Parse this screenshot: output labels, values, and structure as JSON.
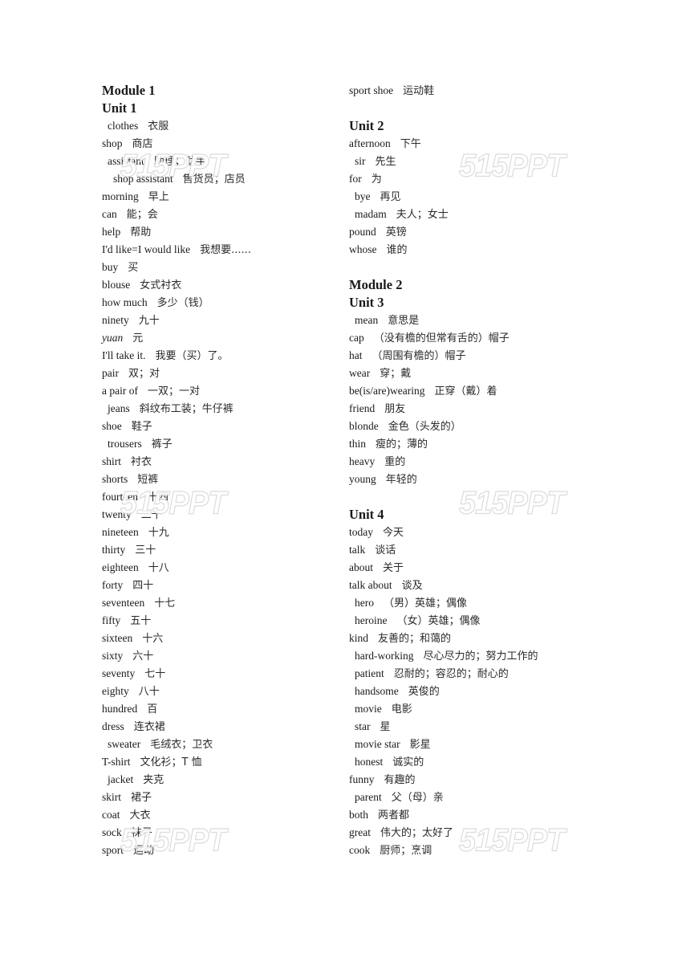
{
  "left_column": [
    {
      "type": "heading",
      "text": "Module 1"
    },
    {
      "type": "heading",
      "text": "Unit 1"
    },
    {
      "type": "entry",
      "en": "clothes",
      "zh": "衣服",
      "indent": 1
    },
    {
      "type": "entry",
      "en": "shop",
      "zh": "商店",
      "indent": 0
    },
    {
      "type": "entry",
      "en": "assistant",
      "zh": "助理；助手",
      "indent": 1
    },
    {
      "type": "entry",
      "en": "shop assistant",
      "zh": "售货员；店员",
      "indent": 2
    },
    {
      "type": "entry",
      "en": "morning",
      "zh": "早上",
      "indent": 0
    },
    {
      "type": "entry",
      "en": "can",
      "zh": "能；会",
      "indent": 0
    },
    {
      "type": "entry",
      "en": "help",
      "zh": "帮助",
      "indent": 0
    },
    {
      "type": "entry",
      "en": "I'd like=I would like",
      "zh": "我想要......",
      "indent": 0
    },
    {
      "type": "entry",
      "en": "buy",
      "zh": "买",
      "indent": 0
    },
    {
      "type": "entry",
      "en": "blouse",
      "zh": "女式衬衣",
      "indent": 0
    },
    {
      "type": "entry",
      "en": "how much",
      "zh": "多少（钱）",
      "indent": 0
    },
    {
      "type": "entry",
      "en": "ninety",
      "zh": "九十",
      "indent": 0
    },
    {
      "type": "entry",
      "en": "yuan",
      "zh": "元",
      "indent": 0,
      "italic": true
    },
    {
      "type": "entry",
      "en": "I'll take it.",
      "zh": "我要（买）了。",
      "indent": 0
    },
    {
      "type": "entry",
      "en": "pair",
      "zh": "双；对",
      "indent": 0
    },
    {
      "type": "entry",
      "en": "a pair of",
      "zh": "一双；一对",
      "indent": 0
    },
    {
      "type": "entry",
      "en": "jeans",
      "zh": "斜纹布工装；牛仔裤",
      "indent": 1
    },
    {
      "type": "entry",
      "en": "shoe",
      "zh": "鞋子",
      "indent": 0
    },
    {
      "type": "entry",
      "en": "trousers",
      "zh": "裤子",
      "indent": 1
    },
    {
      "type": "entry",
      "en": "shirt",
      "zh": "衬衣",
      "indent": 0
    },
    {
      "type": "entry",
      "en": "shorts",
      "zh": "短裤",
      "indent": 0
    },
    {
      "type": "entry",
      "en": "fourteen",
      "zh": "十四",
      "indent": 0
    },
    {
      "type": "entry",
      "en": "twenty",
      "zh": "二十",
      "indent": 0
    },
    {
      "type": "entry",
      "en": "nineteen",
      "zh": "十九",
      "indent": 0
    },
    {
      "type": "entry",
      "en": "thirty",
      "zh": "三十",
      "indent": 0
    },
    {
      "type": "entry",
      "en": "eighteen",
      "zh": "十八",
      "indent": 0
    },
    {
      "type": "entry",
      "en": "forty",
      "zh": "四十",
      "indent": 0
    },
    {
      "type": "entry",
      "en": "seventeen",
      "zh": "十七",
      "indent": 0
    },
    {
      "type": "entry",
      "en": "fifty",
      "zh": "五十",
      "indent": 0
    },
    {
      "type": "entry",
      "en": "sixteen",
      "zh": "十六",
      "indent": 0
    },
    {
      "type": "entry",
      "en": "sixty",
      "zh": "六十",
      "indent": 0
    },
    {
      "type": "entry",
      "en": "seventy",
      "zh": "七十",
      "indent": 0
    },
    {
      "type": "entry",
      "en": "eighty",
      "zh": "八十",
      "indent": 0
    },
    {
      "type": "entry",
      "en": "hundred",
      "zh": "百",
      "indent": 0
    },
    {
      "type": "entry",
      "en": "dress",
      "zh": "连衣裙",
      "indent": 0
    },
    {
      "type": "entry",
      "en": "sweater",
      "zh": "毛绒衣；卫衣",
      "indent": 1
    },
    {
      "type": "entry",
      "en": "T-shirt",
      "zh": "文化衫；T 恤",
      "indent": 0
    },
    {
      "type": "entry",
      "en": "jacket",
      "zh": "夹克",
      "indent": 1
    },
    {
      "type": "entry",
      "en": "skirt",
      "zh": "裙子",
      "indent": 0
    },
    {
      "type": "entry",
      "en": "coat",
      "zh": "大衣",
      "indent": 0
    },
    {
      "type": "entry",
      "en": "sock",
      "zh": "袜子",
      "indent": 0
    },
    {
      "type": "entry",
      "en": "sport",
      "zh": "运动",
      "indent": 0
    }
  ],
  "right_column": [
    {
      "type": "entry",
      "en": "sport shoe",
      "zh": "运动鞋",
      "indent": 0
    },
    {
      "type": "spacer"
    },
    {
      "type": "heading",
      "text": "Unit 2"
    },
    {
      "type": "entry",
      "en": "afternoon",
      "zh": "下午",
      "indent": 0
    },
    {
      "type": "entry",
      "en": "sir",
      "zh": "先生",
      "indent": 1
    },
    {
      "type": "entry",
      "en": "for",
      "zh": "为",
      "indent": 0
    },
    {
      "type": "entry",
      "en": "bye",
      "zh": "再见",
      "indent": 1
    },
    {
      "type": "entry",
      "en": "madam",
      "zh": "夫人；女士",
      "indent": 1
    },
    {
      "type": "entry",
      "en": "pound",
      "zh": "英镑",
      "indent": 0
    },
    {
      "type": "entry",
      "en": "whose",
      "zh": "谁的",
      "indent": 0
    },
    {
      "type": "spacer"
    },
    {
      "type": "heading",
      "text": "Module 2"
    },
    {
      "type": "heading",
      "text": "Unit 3"
    },
    {
      "type": "entry",
      "en": "mean",
      "zh": "意思是",
      "indent": 1
    },
    {
      "type": "entry",
      "en": "cap",
      "zh": "（没有檐的但常有舌的）帽子",
      "indent": 0
    },
    {
      "type": "entry",
      "en": "hat",
      "zh": "（周围有檐的）帽子",
      "indent": 0
    },
    {
      "type": "entry",
      "en": "wear",
      "zh": "穿；戴",
      "indent": 0
    },
    {
      "type": "entry",
      "en": "be(is/are)wearing",
      "zh": "正穿（戴）着",
      "indent": 0
    },
    {
      "type": "entry",
      "en": "friend",
      "zh": "朋友",
      "indent": 0
    },
    {
      "type": "entry",
      "en": "blonde",
      "zh": "金色（头发的）",
      "indent": 0
    },
    {
      "type": "entry",
      "en": "thin",
      "zh": "瘦的；薄的",
      "indent": 0
    },
    {
      "type": "entry",
      "en": "heavy",
      "zh": "重的",
      "indent": 0
    },
    {
      "type": "entry",
      "en": "young",
      "zh": "年轻的",
      "indent": 0
    },
    {
      "type": "spacer"
    },
    {
      "type": "heading",
      "text": "Unit 4"
    },
    {
      "type": "entry",
      "en": "today",
      "zh": "今天",
      "indent": 0
    },
    {
      "type": "entry",
      "en": "talk",
      "zh": "谈话",
      "indent": 0
    },
    {
      "type": "entry",
      "en": "about",
      "zh": "关于",
      "indent": 0
    },
    {
      "type": "entry",
      "en": "talk about",
      "zh": "谈及",
      "indent": 0
    },
    {
      "type": "entry",
      "en": "hero",
      "zh": "（男）英雄；偶像",
      "indent": 1
    },
    {
      "type": "entry",
      "en": "heroine",
      "zh": "（女）英雄；偶像",
      "indent": 1
    },
    {
      "type": "entry",
      "en": "kind",
      "zh": "友善的；和蔼的",
      "indent": 0
    },
    {
      "type": "entry",
      "en": "hard-working",
      "zh": "尽心尽力的；努力工作的",
      "indent": 1
    },
    {
      "type": "entry",
      "en": "patient",
      "zh": "忍耐的；容忍的；耐心的",
      "indent": 1
    },
    {
      "type": "entry",
      "en": "handsome",
      "zh": "英俊的",
      "indent": 1
    },
    {
      "type": "entry",
      "en": "movie",
      "zh": "电影",
      "indent": 1
    },
    {
      "type": "entry",
      "en": "star",
      "zh": "星",
      "indent": 1
    },
    {
      "type": "entry",
      "en": "movie star",
      "zh": "影星",
      "indent": 1
    },
    {
      "type": "entry",
      "en": "honest",
      "zh": "诚实的",
      "indent": 1
    },
    {
      "type": "entry",
      "en": "funny",
      "zh": "有趣的",
      "indent": 0
    },
    {
      "type": "entry",
      "en": "parent",
      "zh": "父（母）亲",
      "indent": 1
    },
    {
      "type": "entry",
      "en": "both",
      "zh": "两者都",
      "indent": 0
    },
    {
      "type": "entry",
      "en": "great",
      "zh": "伟大的；太好了",
      "indent": 0
    },
    {
      "type": "entry",
      "en": "cook",
      "zh": "厨师；烹调",
      "indent": 0
    }
  ],
  "watermark": {
    "text": "515PPT"
  }
}
